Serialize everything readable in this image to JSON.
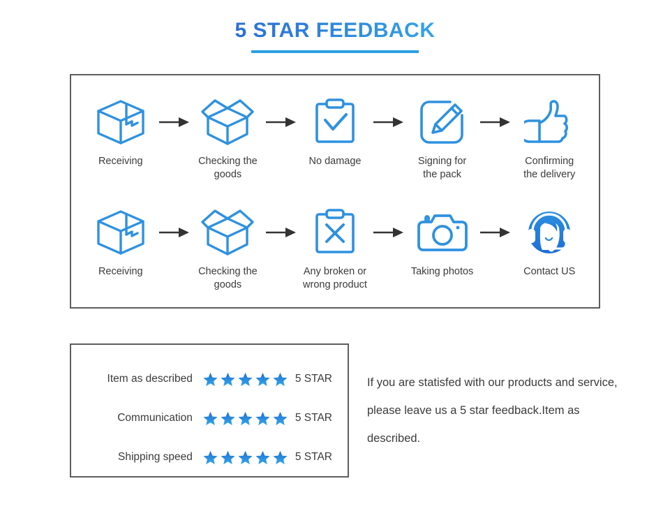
{
  "header": {
    "title": "5 STAR FEEDBACK",
    "accent_color": "#29a0e0",
    "title_gradient_from": "#2b6fd4",
    "title_gradient_to": "#34a3e8"
  },
  "flow": {
    "border_color": "#5e5e5e",
    "arrow_color": "#333333",
    "icon_color": "#2e91e0",
    "rows": [
      {
        "steps": [
          {
            "icon": "closed-box-icon",
            "label": "Receiving"
          },
          {
            "icon": "open-box-icon",
            "label": "Checking the\ngoods"
          },
          {
            "icon": "clipboard-check-icon",
            "label": "No damage"
          },
          {
            "icon": "pencil-edit-icon",
            "label": "Signing for\nthe pack"
          },
          {
            "icon": "thumbs-up-icon",
            "label": "Confirming\nthe delivery"
          }
        ],
        "arrow": "arrow-right-icon"
      },
      {
        "steps": [
          {
            "icon": "closed-box-icon",
            "label": "Receiving"
          },
          {
            "icon": "open-box-icon",
            "label": "Checking the\ngoods"
          },
          {
            "icon": "clipboard-x-icon",
            "label": "Any broken or\nwrong product"
          },
          {
            "icon": "camera-icon",
            "label": "Taking photos"
          },
          {
            "icon": "headset-support-icon",
            "label": "Contact US"
          }
        ],
        "arrow": "arrow-right-icon"
      }
    ]
  },
  "rating": {
    "border_color": "#5e5e5e",
    "star_color_top": "#1f6fd0",
    "star_color_bottom": "#34a8ec",
    "star_count": 5,
    "rows": [
      {
        "label": "Item as described",
        "stars": 5,
        "value": "5 STAR"
      },
      {
        "label": "Communication",
        "stars": 5,
        "value": "5 STAR"
      },
      {
        "label": "Shipping speed",
        "stars": 5,
        "value": "5 STAR"
      }
    ]
  },
  "note": {
    "text": "If you are statisfed with our products and service, please leave us a 5 star feedback.Item as described."
  }
}
